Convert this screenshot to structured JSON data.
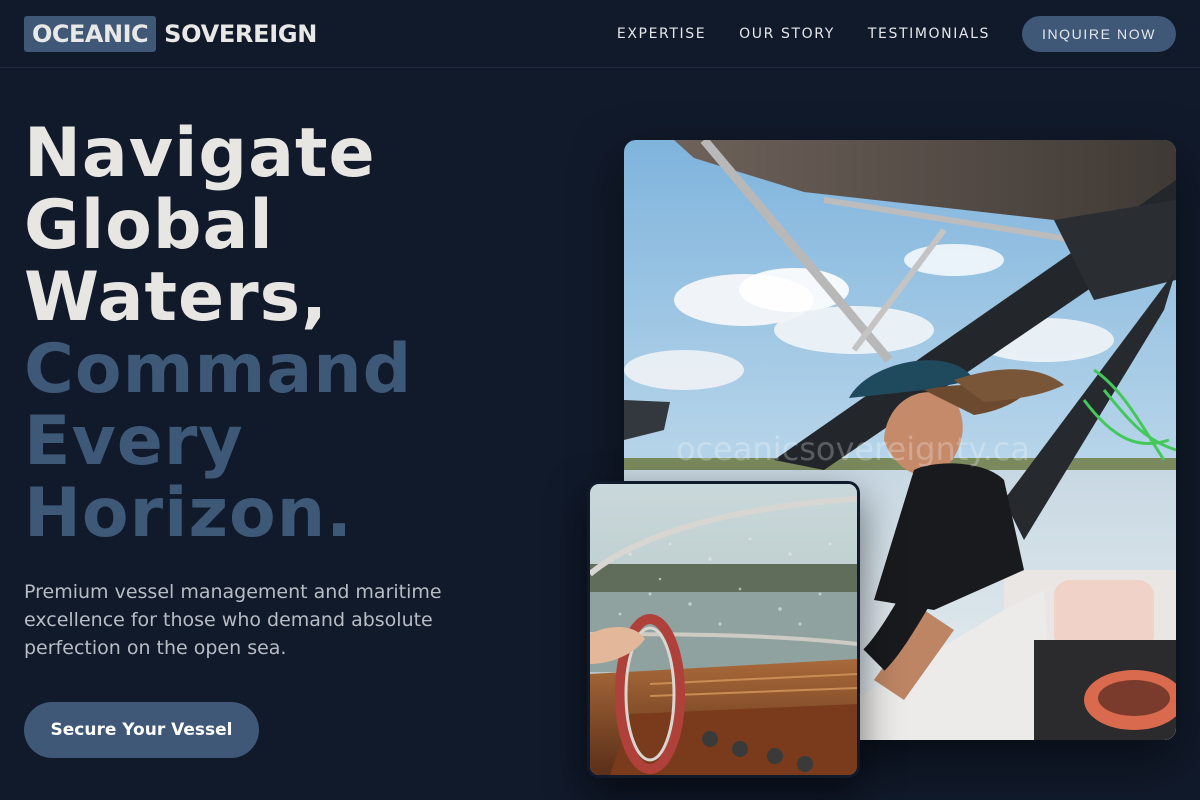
{
  "brand": {
    "highlight": "OCEANIC",
    "rest": "SOVEREIGN"
  },
  "nav": {
    "links": [
      "EXPERTISE",
      "OUR STORY",
      "TESTIMONIALS"
    ],
    "cta": "INQUIRE NOW"
  },
  "hero": {
    "headline_light": [
      "Navigate",
      "Global",
      "Waters,"
    ],
    "headline_dark": [
      "Command",
      "Every",
      "Horizon."
    ],
    "subtitle": "Premium vessel management and maritime excellence for those who demand absolute perfection on the open sea.",
    "cta": "Secure Your Vessel"
  },
  "images": {
    "main_alt": "man-driving-wakeboard-boat-photo",
    "secondary_alt": "boat-steering-wheel-windshield-photo",
    "watermark": "oceanicsovereignty.ca"
  },
  "colors": {
    "background": "#111a2b",
    "accent": "#3f5877",
    "headline_light": "#e8e6e3",
    "headline_dark": "#3e5878"
  }
}
